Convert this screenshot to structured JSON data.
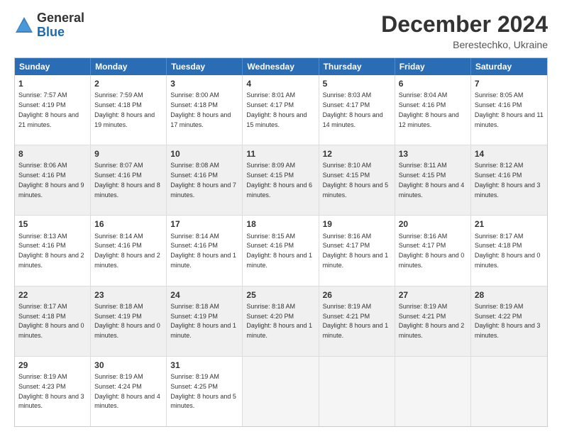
{
  "logo": {
    "general": "General",
    "blue": "Blue"
  },
  "title": "December 2024",
  "subtitle": "Berestechko, Ukraine",
  "days": [
    "Sunday",
    "Monday",
    "Tuesday",
    "Wednesday",
    "Thursday",
    "Friday",
    "Saturday"
  ],
  "weeks": [
    [
      {
        "day": "1",
        "sunrise": "7:57 AM",
        "sunset": "4:19 PM",
        "daylight": "8 hours and 21 minutes."
      },
      {
        "day": "2",
        "sunrise": "7:59 AM",
        "sunset": "4:18 PM",
        "daylight": "8 hours and 19 minutes."
      },
      {
        "day": "3",
        "sunrise": "8:00 AM",
        "sunset": "4:18 PM",
        "daylight": "8 hours and 17 minutes."
      },
      {
        "day": "4",
        "sunrise": "8:01 AM",
        "sunset": "4:17 PM",
        "daylight": "8 hours and 15 minutes."
      },
      {
        "day": "5",
        "sunrise": "8:03 AM",
        "sunset": "4:17 PM",
        "daylight": "8 hours and 14 minutes."
      },
      {
        "day": "6",
        "sunrise": "8:04 AM",
        "sunset": "4:16 PM",
        "daylight": "8 hours and 12 minutes."
      },
      {
        "day": "7",
        "sunrise": "8:05 AM",
        "sunset": "4:16 PM",
        "daylight": "8 hours and 11 minutes."
      }
    ],
    [
      {
        "day": "8",
        "sunrise": "8:06 AM",
        "sunset": "4:16 PM",
        "daylight": "8 hours and 9 minutes."
      },
      {
        "day": "9",
        "sunrise": "8:07 AM",
        "sunset": "4:16 PM",
        "daylight": "8 hours and 8 minutes."
      },
      {
        "day": "10",
        "sunrise": "8:08 AM",
        "sunset": "4:16 PM",
        "daylight": "8 hours and 7 minutes."
      },
      {
        "day": "11",
        "sunrise": "8:09 AM",
        "sunset": "4:15 PM",
        "daylight": "8 hours and 6 minutes."
      },
      {
        "day": "12",
        "sunrise": "8:10 AM",
        "sunset": "4:15 PM",
        "daylight": "8 hours and 5 minutes."
      },
      {
        "day": "13",
        "sunrise": "8:11 AM",
        "sunset": "4:15 PM",
        "daylight": "8 hours and 4 minutes."
      },
      {
        "day": "14",
        "sunrise": "8:12 AM",
        "sunset": "4:16 PM",
        "daylight": "8 hours and 3 minutes."
      }
    ],
    [
      {
        "day": "15",
        "sunrise": "8:13 AM",
        "sunset": "4:16 PM",
        "daylight": "8 hours and 2 minutes."
      },
      {
        "day": "16",
        "sunrise": "8:14 AM",
        "sunset": "4:16 PM",
        "daylight": "8 hours and 2 minutes."
      },
      {
        "day": "17",
        "sunrise": "8:14 AM",
        "sunset": "4:16 PM",
        "daylight": "8 hours and 1 minute."
      },
      {
        "day": "18",
        "sunrise": "8:15 AM",
        "sunset": "4:16 PM",
        "daylight": "8 hours and 1 minute."
      },
      {
        "day": "19",
        "sunrise": "8:16 AM",
        "sunset": "4:17 PM",
        "daylight": "8 hours and 1 minute."
      },
      {
        "day": "20",
        "sunrise": "8:16 AM",
        "sunset": "4:17 PM",
        "daylight": "8 hours and 0 minutes."
      },
      {
        "day": "21",
        "sunrise": "8:17 AM",
        "sunset": "4:18 PM",
        "daylight": "8 hours and 0 minutes."
      }
    ],
    [
      {
        "day": "22",
        "sunrise": "8:17 AM",
        "sunset": "4:18 PM",
        "daylight": "8 hours and 0 minutes."
      },
      {
        "day": "23",
        "sunrise": "8:18 AM",
        "sunset": "4:19 PM",
        "daylight": "8 hours and 0 minutes."
      },
      {
        "day": "24",
        "sunrise": "8:18 AM",
        "sunset": "4:19 PM",
        "daylight": "8 hours and 1 minute."
      },
      {
        "day": "25",
        "sunrise": "8:18 AM",
        "sunset": "4:20 PM",
        "daylight": "8 hours and 1 minute."
      },
      {
        "day": "26",
        "sunrise": "8:19 AM",
        "sunset": "4:21 PM",
        "daylight": "8 hours and 1 minute."
      },
      {
        "day": "27",
        "sunrise": "8:19 AM",
        "sunset": "4:21 PM",
        "daylight": "8 hours and 2 minutes."
      },
      {
        "day": "28",
        "sunrise": "8:19 AM",
        "sunset": "4:22 PM",
        "daylight": "8 hours and 3 minutes."
      }
    ],
    [
      {
        "day": "29",
        "sunrise": "8:19 AM",
        "sunset": "4:23 PM",
        "daylight": "8 hours and 3 minutes."
      },
      {
        "day": "30",
        "sunrise": "8:19 AM",
        "sunset": "4:24 PM",
        "daylight": "8 hours and 4 minutes."
      },
      {
        "day": "31",
        "sunrise": "8:19 AM",
        "sunset": "4:25 PM",
        "daylight": "8 hours and 5 minutes."
      },
      null,
      null,
      null,
      null
    ]
  ],
  "labels": {
    "sunrise": "Sunrise:",
    "sunset": "Sunset:",
    "daylight": "Daylight:"
  }
}
